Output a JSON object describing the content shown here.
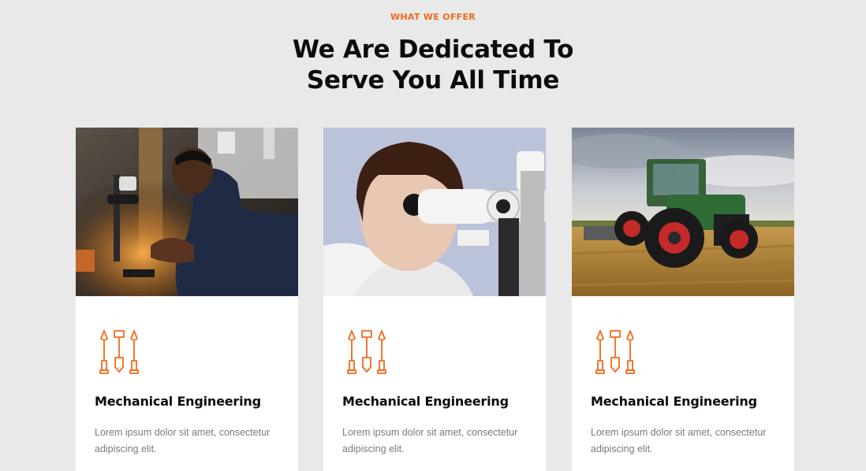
{
  "header": {
    "eyebrow": "WHAT WE OFFER",
    "title_line1": "We Are Dedicated To",
    "title_line2": "Serve You All Time"
  },
  "colors": {
    "accent": "#f26a1b",
    "background": "#e9e9e9",
    "card": "#ffffff",
    "text_dark": "#0c0c0c",
    "text_muted": "#7a7a7a"
  },
  "cards": [
    {
      "image": "technician-soldering-photo",
      "icon": "tools-icon",
      "title": "Mechanical Engineering",
      "description": "Lorem ipsum dolor sit amet, consectetur adipiscing elit."
    },
    {
      "image": "scientist-microscope-photo",
      "icon": "tools-icon",
      "title": "Mechanical Engineering",
      "description": "Lorem ipsum dolor sit amet, consectetur adipiscing elit."
    },
    {
      "image": "tractor-field-photo",
      "icon": "tools-icon",
      "title": "Mechanical Engineering",
      "description": "Lorem ipsum dolor sit amet, consectetur adipiscing elit."
    }
  ]
}
